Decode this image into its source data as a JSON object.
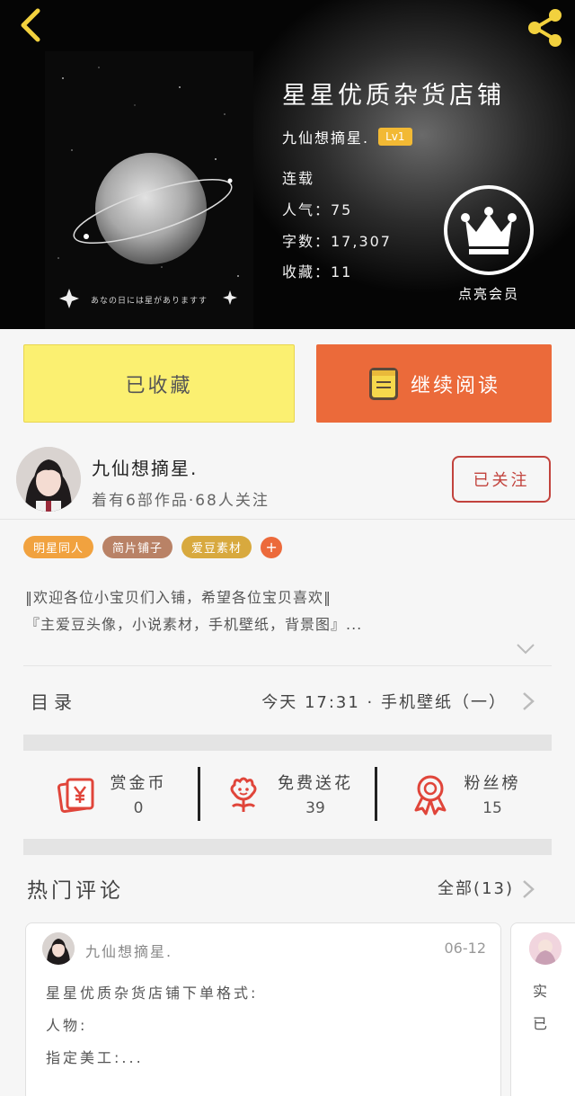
{
  "header": {
    "back_icon": "chevron-left-icon",
    "share_icon": "share-icon",
    "cover_caption": "あなの日には星がありますす"
  },
  "book": {
    "title": "星星优质杂货店铺",
    "author": "九仙想摘星.",
    "level": "Lv1",
    "status": "连载",
    "popularity": "人气：75",
    "words": "字数：17,307",
    "favorites": "收藏：11",
    "vip_label": "点亮会员"
  },
  "actions": {
    "collected_label": "已收藏",
    "read_label": "继续阅读"
  },
  "author": {
    "name": "九仙想摘星.",
    "meta": "着有6部作品·68人关注",
    "follow_label": "已关注"
  },
  "tags": [
    "明星同人",
    "简片铺子",
    "爱豆素材"
  ],
  "tag_add": "+",
  "description": {
    "line1": "‖欢迎各位小宝贝们入铺，希望各位宝贝喜欢‖",
    "line2": "『主爱豆头像，小说素材，手机壁纸，背景图』..."
  },
  "catalog": {
    "label": "目录",
    "latest": "今天 17:31 · 手机壁纸（一）"
  },
  "stats": [
    {
      "icon": "reward-coin-icon",
      "label": "赏金币",
      "value": "0"
    },
    {
      "icon": "flower-icon",
      "label": "免费送花",
      "value": "39"
    },
    {
      "icon": "fan-rank-medal-icon",
      "label": "粉丝榜",
      "value": "15"
    }
  ],
  "comments": {
    "title": "热门评论",
    "all_label": "全部(13)",
    "items": [
      {
        "user": "九仙想摘星.",
        "date": "06-12",
        "body": "星星优质杂货店铺下单格式:\n人物:\n指定美工:..."
      },
      {
        "body": "实\n已"
      }
    ]
  },
  "colors": {
    "accent_orange": "#eb6a3a",
    "collected_yellow": "#fbf071",
    "follow_red": "#c2433d",
    "level_badge": "#f2b934"
  }
}
